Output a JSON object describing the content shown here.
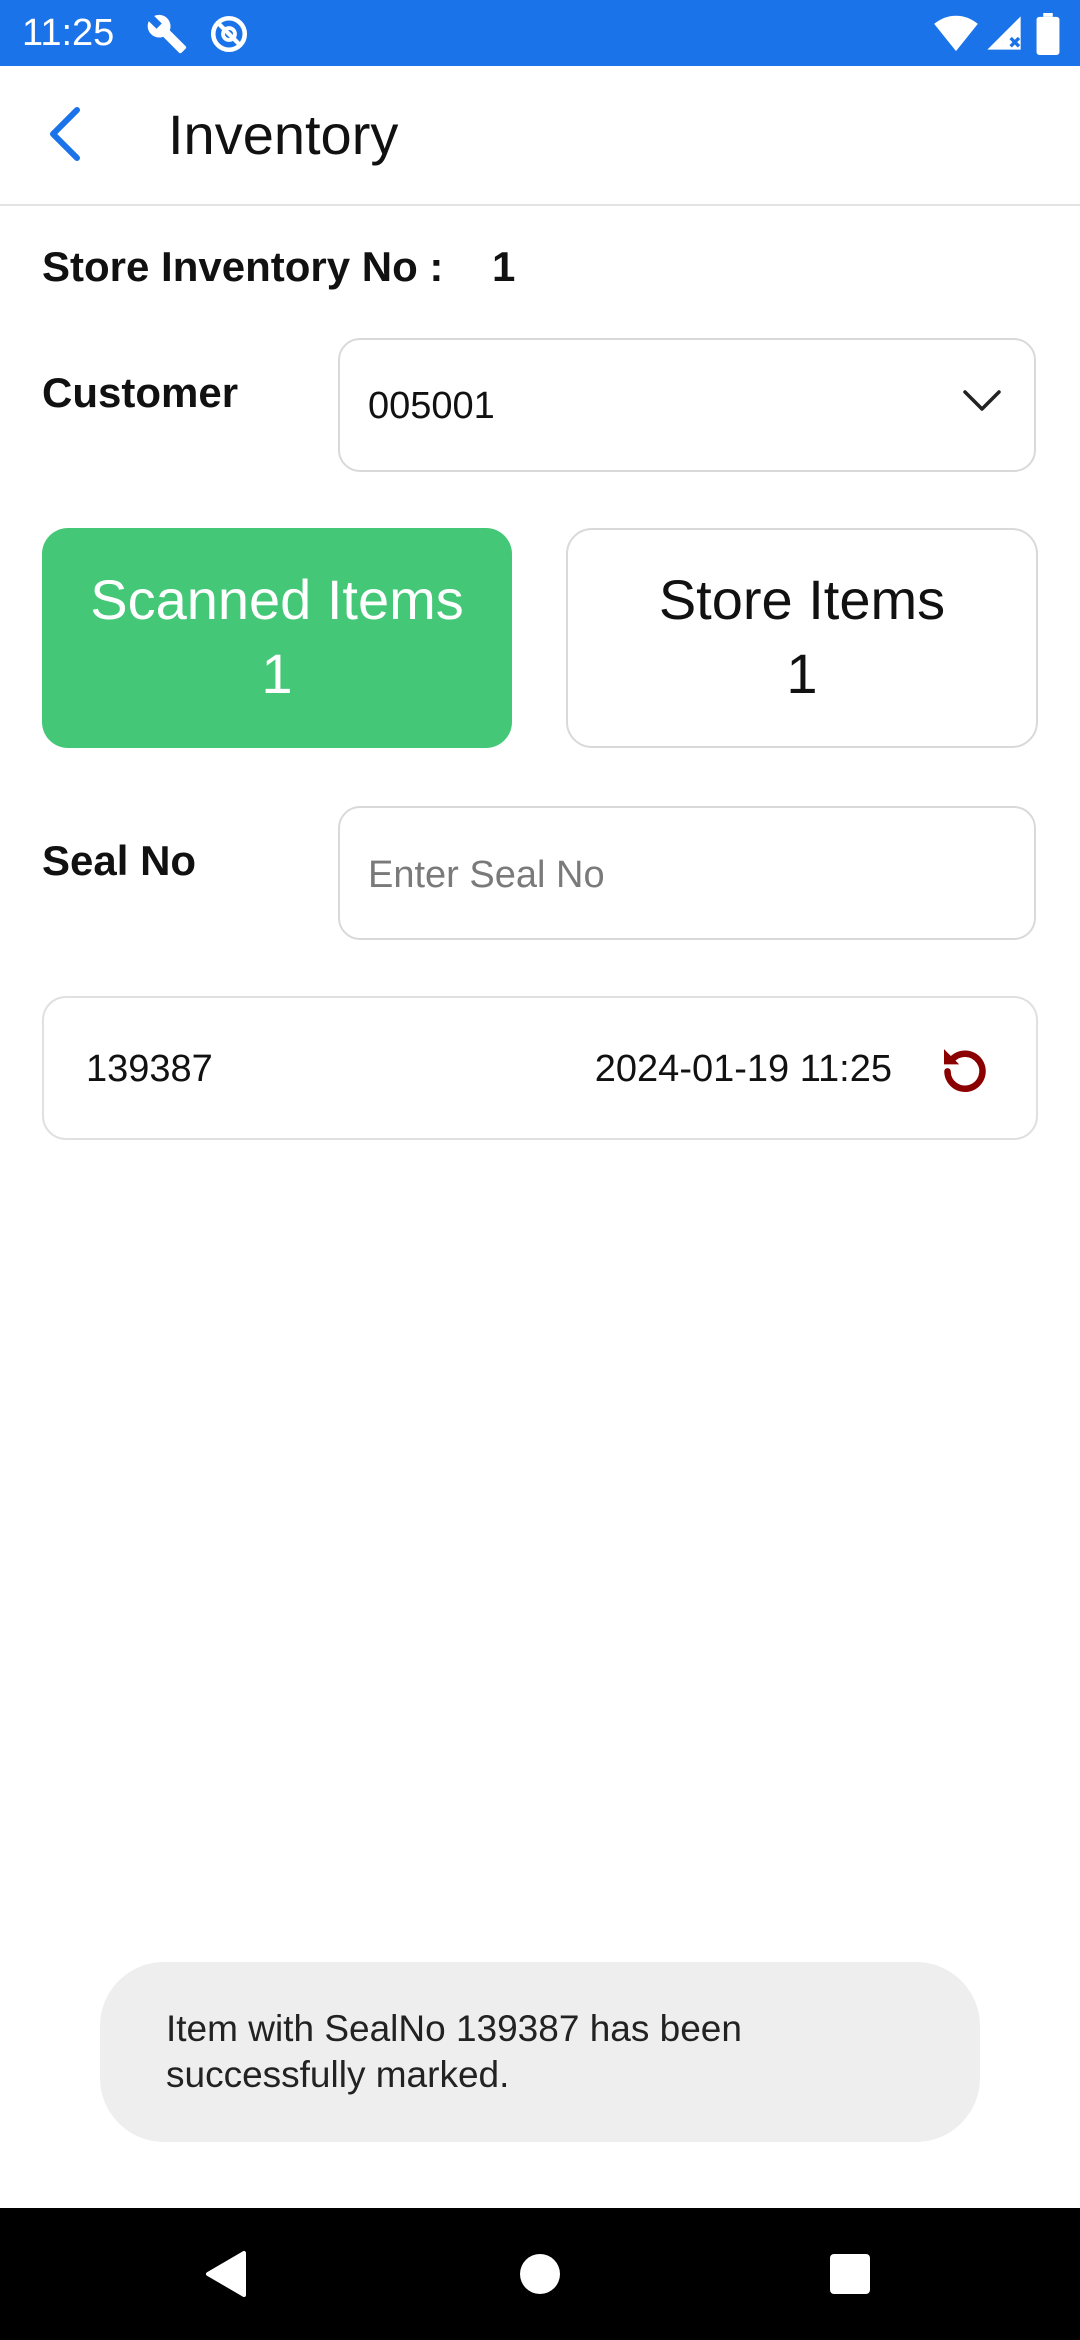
{
  "status_bar": {
    "time": "11:25",
    "icons": [
      "wrench-icon",
      "vpn-icon",
      "wifi-icon",
      "signal-icon",
      "battery-icon"
    ]
  },
  "app_bar": {
    "title": "Inventory",
    "back_icon": "chevron-left-icon"
  },
  "store_inventory": {
    "label": "Store Inventory No :",
    "value": "1"
  },
  "customer": {
    "label": "Customer",
    "selected": "005001"
  },
  "counts": {
    "scanned_label": "Scanned Items",
    "scanned_count": "1",
    "store_label": "Store Items",
    "store_count": "1"
  },
  "seal": {
    "label": "Seal No",
    "placeholder": "Enter Seal No",
    "value": ""
  },
  "scanned_list": [
    {
      "seal_no": "139387",
      "timestamp": "2024-01-19  11:25"
    }
  ],
  "toast": {
    "message": "Item with SealNo 139387 has been successfully marked."
  },
  "colors": {
    "status_bar": "#1a73e8",
    "accent_blue": "#1a73e8",
    "scanned_card": "#44c877",
    "undo_icon": "#8b0000",
    "toast_bg": "#eeeeee"
  }
}
